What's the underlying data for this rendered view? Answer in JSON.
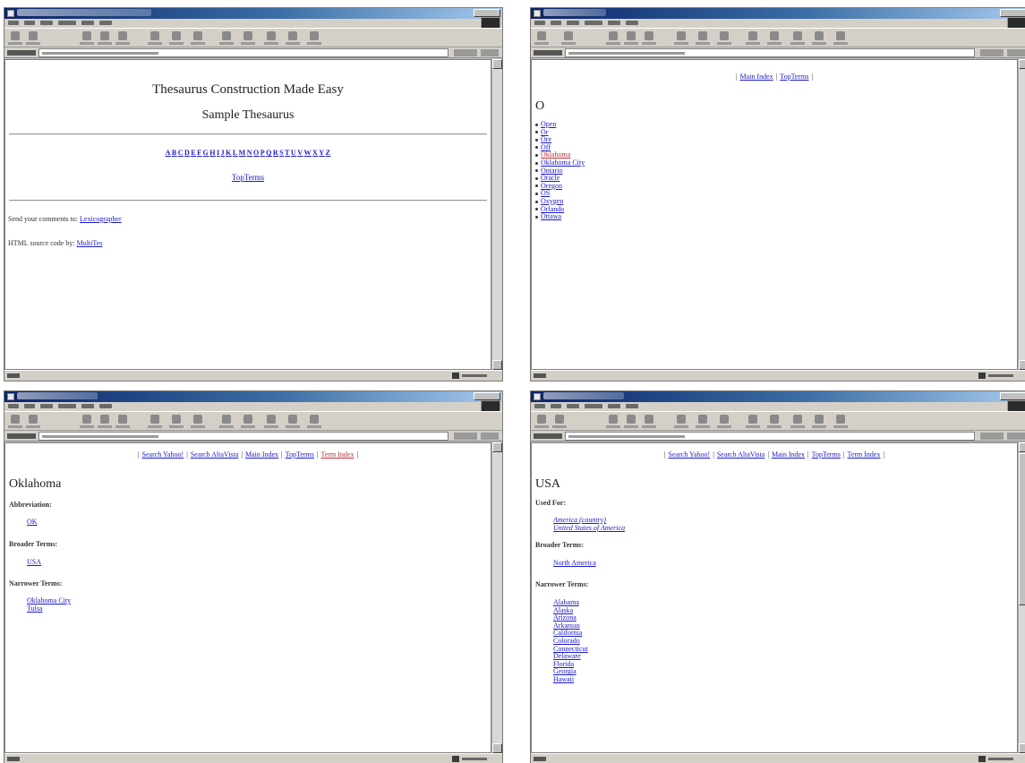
{
  "win1": {
    "title": "Thesaurus Construction Made Easy",
    "subtitle": "Sample Thesaurus",
    "alphabet": [
      "A",
      "B",
      "C",
      "D",
      "E",
      "F",
      "G",
      "H",
      "I",
      "J",
      "K",
      "L",
      "M",
      "N",
      "O",
      "P",
      "Q",
      "R",
      "S",
      "T",
      "U",
      "V",
      "W",
      "X",
      "Y",
      "Z"
    ],
    "top_terms_link": "TopTerms",
    "feedback_prefix": "Send your comments to:",
    "feedback_link": "Lexicographer",
    "credit_prefix": "HTML source code by:",
    "credit_link": "MultiTes"
  },
  "win2": {
    "nav": [
      "Main Index",
      "TopTerms"
    ],
    "letter": "O",
    "items": [
      "Open",
      "Or",
      "Ore",
      "Off",
      "Oklahoma",
      "Oklahoma City",
      "Ontario",
      "Oracle",
      "Oregon",
      "OS",
      "Oxygen",
      "Orlando",
      "Ottawa"
    ]
  },
  "win3": {
    "nav": [
      "Search Yahoo!",
      "Search AltaVista",
      "Main Index",
      "TopTerms",
      "Term Index"
    ],
    "heading": "Oklahoma",
    "abbreviation_label": "Abbreviation:",
    "abbreviation_terms": [
      "OK"
    ],
    "broader_label": "Broader Terms:",
    "broader_terms": [
      "USA"
    ],
    "narrower_label": "Narrower Terms:",
    "narrower_terms": [
      "Oklahoma City",
      "Tulsa"
    ]
  },
  "win4": {
    "nav": [
      "Search Yahoo!",
      "Search AltaVista",
      "Main Index",
      "TopTerms",
      "Term Index"
    ],
    "heading": "USA",
    "used_for_label": "Used For:",
    "used_for_terms": [
      "America (country)",
      "United States of America"
    ],
    "broader_label": "Broader Terms:",
    "broader_terms": [
      "North America"
    ],
    "narrower_label": "Narrower Terms:",
    "narrower_terms": [
      "Alabama",
      "Alaska",
      "Arizona",
      "Arkansas",
      "California",
      "Colorado",
      "Connecticut",
      "Delaware",
      "Florida",
      "Georgia",
      "Hawaii"
    ]
  }
}
